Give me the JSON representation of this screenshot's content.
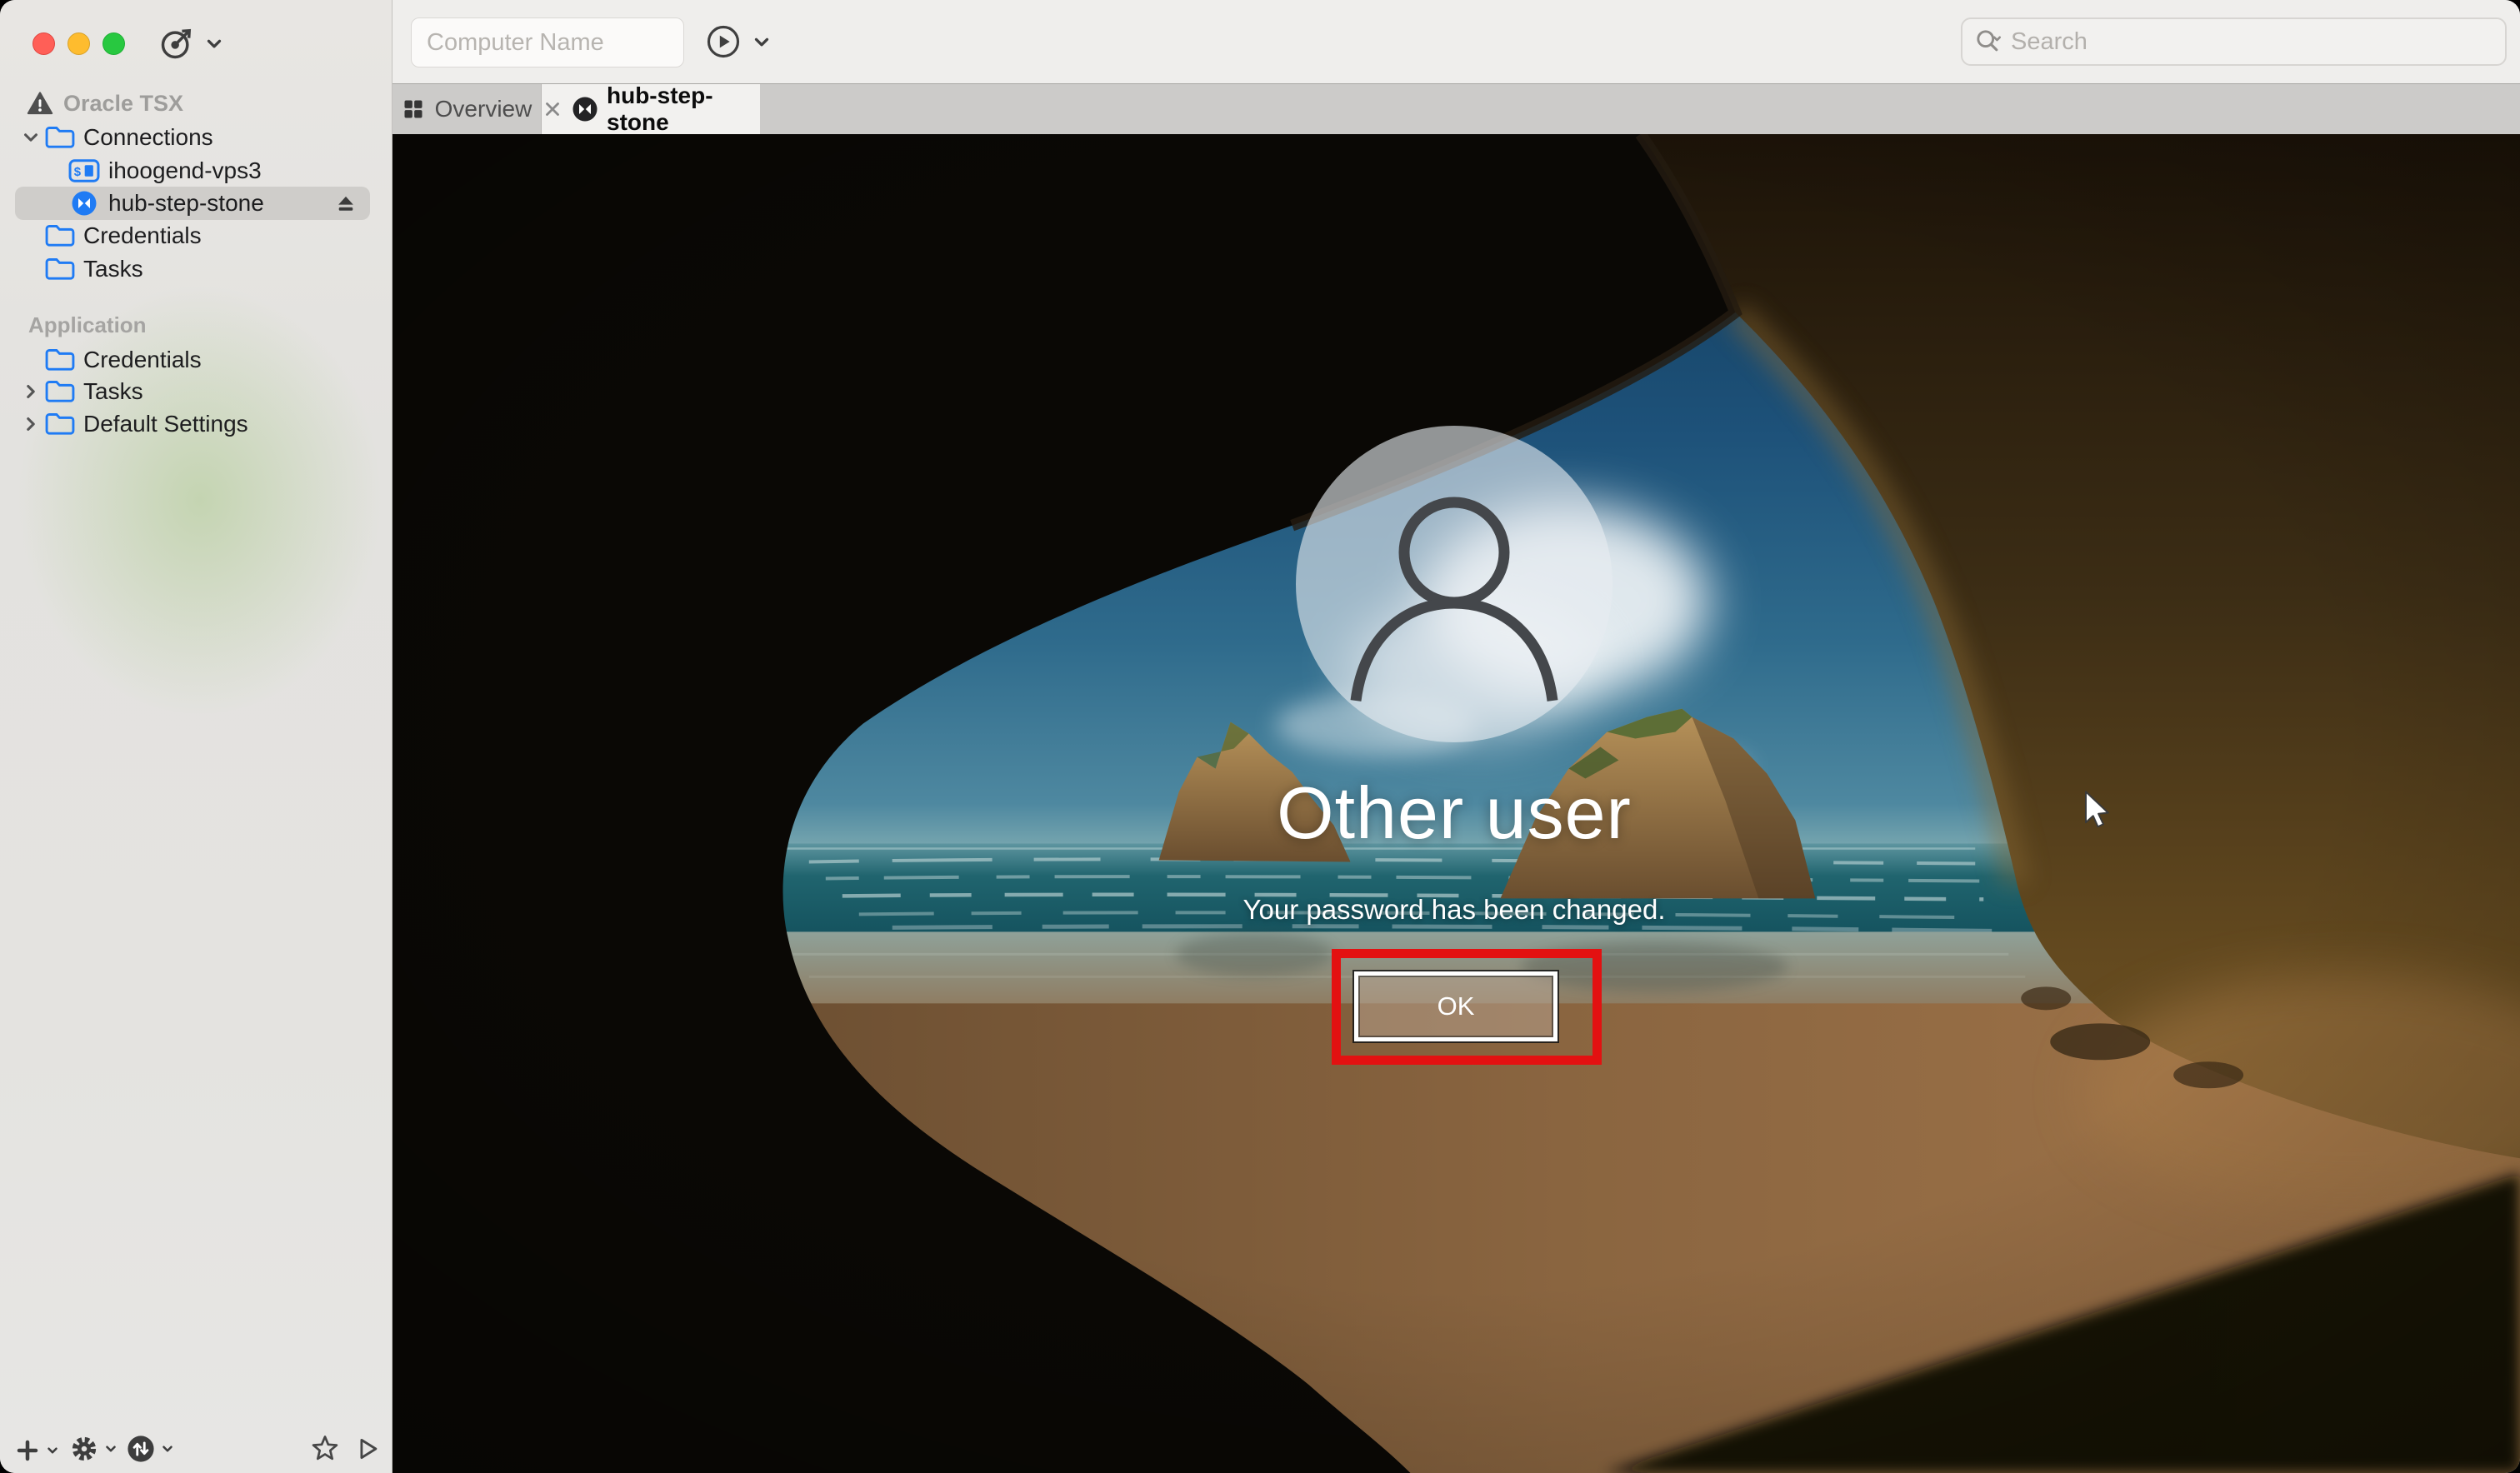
{
  "sidebar": {
    "document": {
      "label": "Oracle TSX"
    },
    "tree": [
      {
        "label": "Connections"
      },
      {
        "label": "ihoogend-vps3"
      },
      {
        "label": "hub-step-stone",
        "selected": true
      },
      {
        "label": "Credentials"
      },
      {
        "label": "Tasks"
      }
    ],
    "application_section": {
      "header": "Application",
      "items": [
        {
          "label": "Credentials"
        },
        {
          "label": "Tasks"
        },
        {
          "label": "Default Settings"
        }
      ]
    }
  },
  "toolbar": {
    "computer_name": {
      "placeholder": "Computer Name",
      "value": ""
    },
    "search": {
      "placeholder": "Search",
      "value": ""
    }
  },
  "tabs": {
    "overview": {
      "label": "Overview"
    },
    "session": {
      "label": "hub-step-stone",
      "active": true
    }
  },
  "lock_screen": {
    "user_label": "Other user",
    "message": "Your password has been changed.",
    "ok_button": "OK"
  },
  "colors": {
    "annotation_red": "#e31111",
    "accent_blue": "#1f7bf4",
    "traffic_red": "#ff5f57",
    "traffic_yellow": "#febc2e",
    "traffic_green": "#28c840",
    "selected_row": "#cfcdca",
    "active_tab": "#f2f1ef"
  }
}
